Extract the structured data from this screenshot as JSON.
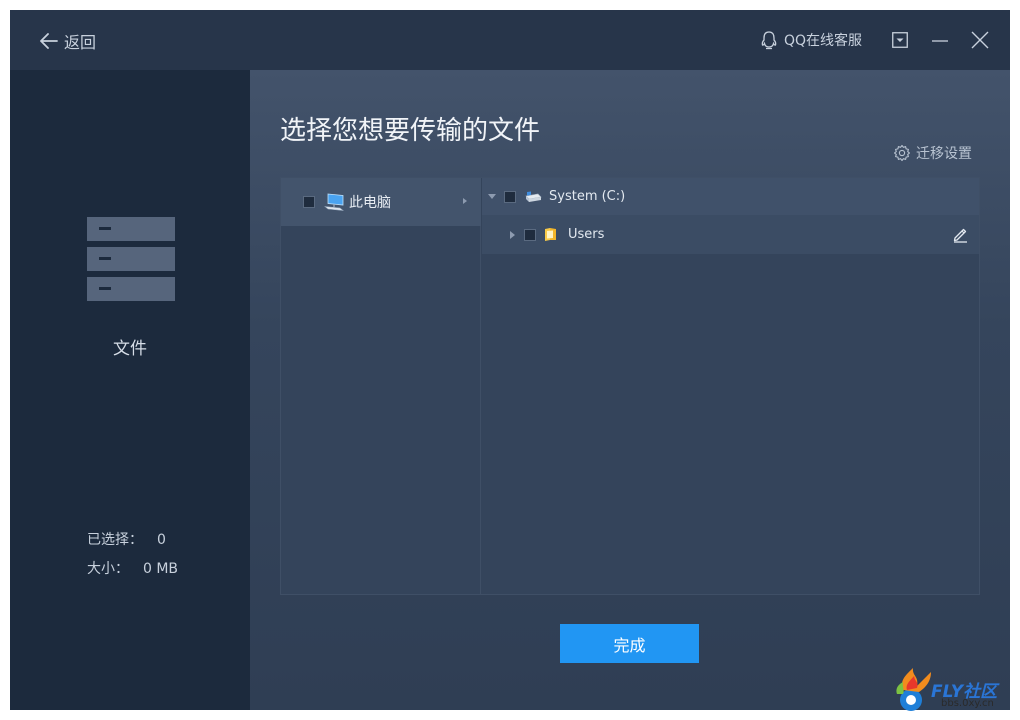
{
  "titlebar": {
    "back_label": "返回",
    "support_label": "QQ在线客服",
    "icons": [
      "arrow-left-icon",
      "qq-icon",
      "dropdown-menu-icon",
      "minimize-icon",
      "close-icon"
    ]
  },
  "sidebar": {
    "icon": "server-rack-icon",
    "title": "文件",
    "selected_label": "已选择：",
    "selected_value": "0",
    "size_label": "大小：",
    "size_value": "0 MB"
  },
  "main": {
    "title": "选择您想要传输的文件",
    "settings_label": "迁移设置",
    "source": {
      "label": "此电脑",
      "icon": "computer-icon"
    },
    "tree": [
      {
        "label": "System (C:)",
        "icon": "drive-icon",
        "expanded": true
      },
      {
        "label": "Users",
        "icon": "folder-icon",
        "expanded": false
      }
    ],
    "done_label": "完成"
  },
  "watermark": {
    "text": "FLY社区",
    "sub": "bbs.0xy.cn"
  },
  "colors": {
    "accent": "#2196f3",
    "window_bg": "#2b3a50",
    "sidebar_bg": "#1c2a3d"
  }
}
